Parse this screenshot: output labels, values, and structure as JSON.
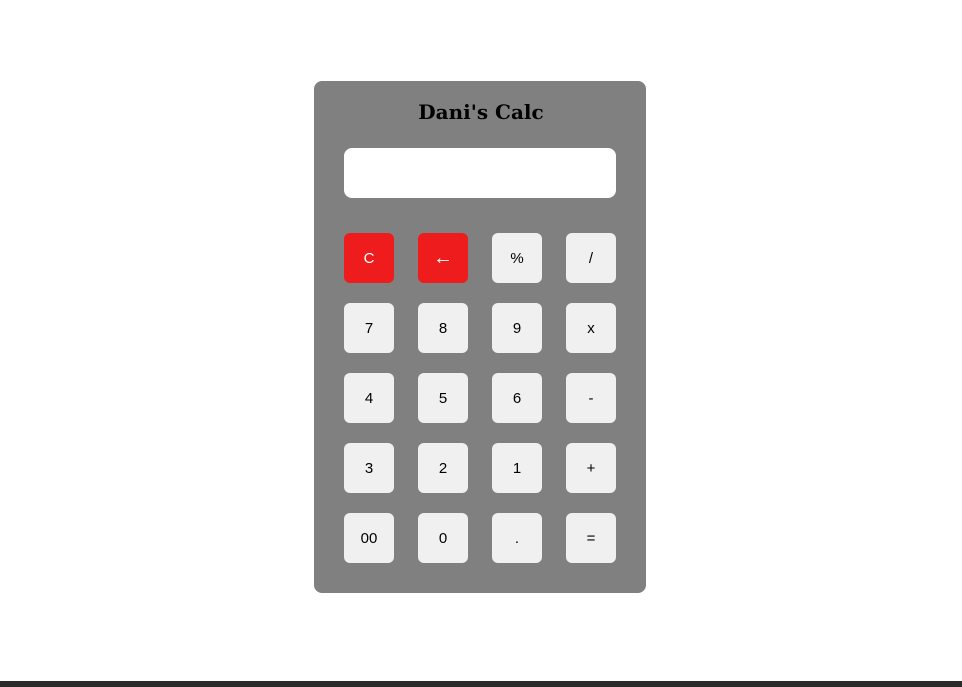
{
  "app": {
    "title": "Dani's Calc"
  },
  "display": {
    "value": ""
  },
  "keys": {
    "clear": "C",
    "backspace": "←",
    "percent": "%",
    "divide": "/",
    "seven": "7",
    "eight": "8",
    "nine": "9",
    "multiply": "x",
    "four": "4",
    "five": "5",
    "six": "6",
    "minus": "-",
    "three": "3",
    "two": "2",
    "one": "1",
    "plus": "+",
    "double_zero": "00",
    "zero": "0",
    "decimal": ".",
    "equals": "="
  },
  "colors": {
    "body_background": "#808080",
    "key_background": "#f0f0f0",
    "danger_key_background": "#ee1c1c",
    "display_background": "#ffffff"
  }
}
